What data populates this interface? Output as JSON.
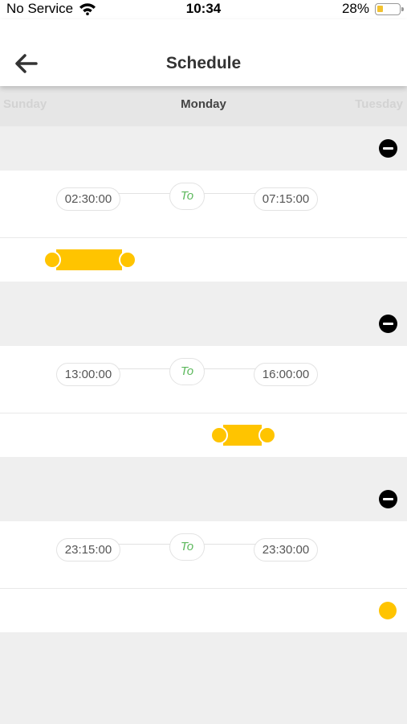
{
  "status_bar": {
    "carrier": "No Service",
    "time": "10:34",
    "battery_percent": "28%",
    "battery_level": 0.28,
    "icons": [
      "wifi-icon",
      "battery-icon"
    ]
  },
  "header": {
    "title": "Schedule",
    "back_icon": "arrow-left-icon"
  },
  "day_tabs": {
    "previous": "Sunday",
    "current": "Monday",
    "next": "Tuesday"
  },
  "schedules": [
    {
      "start": "02:30:00",
      "connector": "To",
      "end": "07:15:00"
    },
    {
      "start": "13:00:00",
      "connector": "To",
      "end": "16:00:00"
    },
    {
      "start": "23:15:00",
      "connector": "To",
      "end": "23:30:00"
    }
  ],
  "colors": {
    "accent": "#ffc400",
    "to_label": "#5cb85c",
    "background": "#efefef"
  }
}
